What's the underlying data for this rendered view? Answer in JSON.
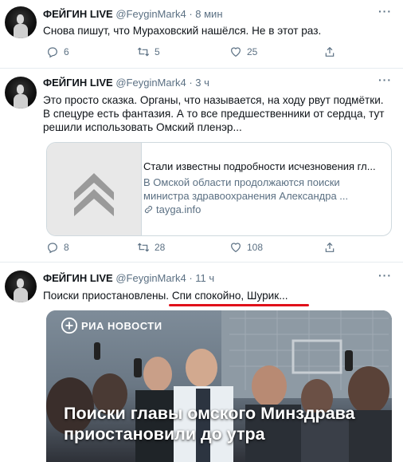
{
  "tweets": [
    {
      "name": "ФЕЙГИН LIVE",
      "handle": "@FeyginMark4",
      "time": "8 мин",
      "text": "Снова пишут, что Мураховский нашёлся. Не в этот раз.",
      "replies": "6",
      "retweets": "5",
      "likes": "25"
    },
    {
      "name": "ФЕЙГИН LIVE",
      "handle": "@FeyginMark4",
      "time": "3 ч",
      "text": "Это просто сказка. Органы, что называется, на ходу рвут подмётки. В спецуре есть фантазия. А то все предшественники от сердца, тут решили использовать Омский пленэр...",
      "card": {
        "title": "Стали известны подробности исчезновения гл...",
        "description": "В Омской области продолжаются поиски министра здравоохранения Александра ...",
        "domain": "tayga.info"
      },
      "replies": "8",
      "retweets": "28",
      "likes": "108"
    },
    {
      "name": "ФЕЙГИН LIVE",
      "handle": "@FeyginMark4",
      "time": "11 ч",
      "text": "Поиски приостановлены. Спи спокойно, Шурик...",
      "media": {
        "source": "РИА НОВОСТИ",
        "headline": "Поиски главы омского Минздрава приостановили до утра"
      }
    }
  ],
  "ui": {
    "separator": "·",
    "more": "···"
  },
  "colors": {
    "text": "#0f1419",
    "secondary": "#5b7083",
    "border": "#cfd9de",
    "underline": "#e0101a"
  }
}
